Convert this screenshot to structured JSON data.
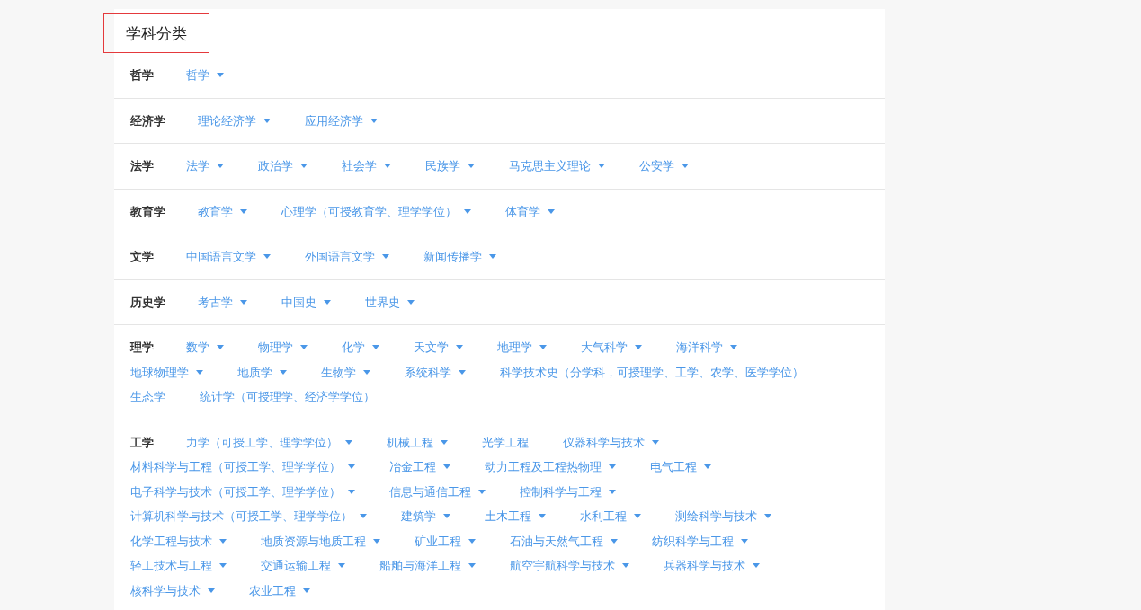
{
  "title": "学科分类",
  "categories": [
    {
      "name": "哲学",
      "items": [
        {
          "label": "哲学",
          "expandable": true
        }
      ]
    },
    {
      "name": "经济学",
      "items": [
        {
          "label": "理论经济学",
          "expandable": true
        },
        {
          "label": "应用经济学",
          "expandable": true
        }
      ]
    },
    {
      "name": "法学",
      "items": [
        {
          "label": "法学",
          "expandable": true
        },
        {
          "label": "政治学",
          "expandable": true
        },
        {
          "label": "社会学",
          "expandable": true
        },
        {
          "label": "民族学",
          "expandable": true
        },
        {
          "label": "马克思主义理论",
          "expandable": true
        },
        {
          "label": "公安学",
          "expandable": true
        }
      ]
    },
    {
      "name": "教育学",
      "items": [
        {
          "label": "教育学",
          "expandable": true
        },
        {
          "label": "心理学（可授教育学、理学学位）",
          "expandable": true
        },
        {
          "label": "体育学",
          "expandable": true
        }
      ]
    },
    {
      "name": "文学",
      "items": [
        {
          "label": "中国语言文学",
          "expandable": true
        },
        {
          "label": "外国语言文学",
          "expandable": true
        },
        {
          "label": "新闻传播学",
          "expandable": true
        }
      ]
    },
    {
      "name": "历史学",
      "items": [
        {
          "label": "考古学",
          "expandable": true
        },
        {
          "label": "中国史",
          "expandable": true
        },
        {
          "label": "世界史",
          "expandable": true
        }
      ]
    },
    {
      "name": "理学",
      "items": [
        {
          "label": "数学",
          "expandable": true
        },
        {
          "label": "物理学",
          "expandable": true
        },
        {
          "label": "化学",
          "expandable": true
        },
        {
          "label": "天文学",
          "expandable": true
        },
        {
          "label": "地理学",
          "expandable": true
        },
        {
          "label": "大气科学",
          "expandable": true
        },
        {
          "label": "海洋科学",
          "expandable": true
        },
        {
          "label": "地球物理学",
          "expandable": true
        },
        {
          "label": "地质学",
          "expandable": true
        },
        {
          "label": "生物学",
          "expandable": true
        },
        {
          "label": "系统科学",
          "expandable": true
        },
        {
          "label": "科学技术史（分学科，可授理学、工学、农学、医学学位）",
          "expandable": false
        },
        {
          "label": "生态学",
          "expandable": false
        },
        {
          "label": "统计学（可授理学、经济学学位）",
          "expandable": false
        }
      ]
    },
    {
      "name": "工学",
      "items": [
        {
          "label": "力学（可授工学、理学学位）",
          "expandable": true
        },
        {
          "label": "机械工程",
          "expandable": true
        },
        {
          "label": "光学工程",
          "expandable": false
        },
        {
          "label": "仪器科学与技术",
          "expandable": true
        },
        {
          "label": "材料科学与工程（可授工学、理学学位）",
          "expandable": true
        },
        {
          "label": "冶金工程",
          "expandable": true
        },
        {
          "label": "动力工程及工程热物理",
          "expandable": true
        },
        {
          "label": "电气工程",
          "expandable": true
        },
        {
          "label": "电子科学与技术（可授工学、理学学位）",
          "expandable": true
        },
        {
          "label": "信息与通信工程",
          "expandable": true
        },
        {
          "label": "控制科学与工程",
          "expandable": true
        },
        {
          "label": "计算机科学与技术（可授工学、理学学位）",
          "expandable": true
        },
        {
          "label": "建筑学",
          "expandable": true
        },
        {
          "label": "土木工程",
          "expandable": true
        },
        {
          "label": "水利工程",
          "expandable": true
        },
        {
          "label": "测绘科学与技术",
          "expandable": true
        },
        {
          "label": "化学工程与技术",
          "expandable": true
        },
        {
          "label": "地质资源与地质工程",
          "expandable": true
        },
        {
          "label": "矿业工程",
          "expandable": true
        },
        {
          "label": "石油与天然气工程",
          "expandable": true
        },
        {
          "label": "纺织科学与工程",
          "expandable": true
        },
        {
          "label": "轻工技术与工程",
          "expandable": true
        },
        {
          "label": "交通运输工程",
          "expandable": true
        },
        {
          "label": "船舶与海洋工程",
          "expandable": true
        },
        {
          "label": "航空宇航科学与技术",
          "expandable": true
        },
        {
          "label": "兵器科学与技术",
          "expandable": true
        },
        {
          "label": "核科学与技术",
          "expandable": true
        },
        {
          "label": "农业工程",
          "expandable": true
        }
      ]
    }
  ]
}
